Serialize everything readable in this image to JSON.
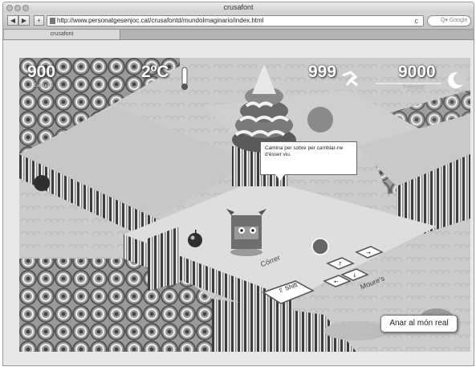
{
  "browser": {
    "window_title": "crusafont",
    "back_label": "◀",
    "forward_label": "▶",
    "add_label": "+",
    "url": "http://www.personatgesenjoc.cat/crusafontd/mundoImaginario/index.html",
    "reload_label": "c",
    "search_placeholder": "Q▾ Google",
    "tab_label": "crusafont"
  },
  "game": {
    "evolucio_value": "900",
    "evolucio_label": "Evolució",
    "temperature": "2ºC",
    "steps_value": "999",
    "score_value": "9000",
    "score_label": "Puntuació",
    "tooltip_text": "Camina per sobre per cambiar-ne d'ésser viu.",
    "correr_label": "Córrer",
    "shift_label": "Shift",
    "moures_label": "Moure's",
    "real_world_button": "Anar al món real"
  },
  "colors": {
    "chrome_bg": "#dcdcdc",
    "game_floor": "#d8d8d8",
    "hud_text": "#ffffff"
  }
}
